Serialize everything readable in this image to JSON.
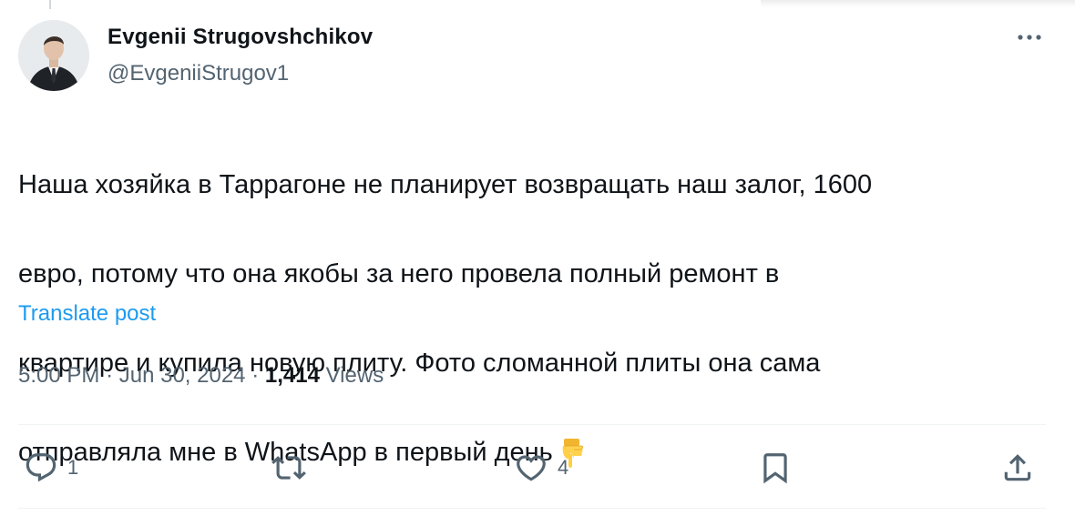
{
  "author": {
    "name": "Evgenii Strugovshchikov",
    "handle": "@EvgeniiStrugov1",
    "avatar_icon": "avatar-photo"
  },
  "post": {
    "text_lines": [
      "Наша хозяйка в Таррагоне не планирует возвращать наш залог, 1600",
      "евро, потому что она якобы за него провела полный ремонт в",
      "квартире и купила новую плиту. Фото сломанной плиты она сама",
      "отправляла мне в WhatsApp в первый день"
    ],
    "emoji": "backhand-index-pointing-down",
    "translate_label": "Translate post"
  },
  "meta": {
    "time": "5:00 PM",
    "separator": "·",
    "date": "Jun 30, 2024",
    "views_count": "1,414",
    "views_label": "Views"
  },
  "actions": {
    "reply_count": "1",
    "retweet_count": "",
    "like_count": "4",
    "icons": [
      "reply-icon",
      "retweet-icon",
      "like-icon",
      "bookmark-icon",
      "share-icon"
    ]
  },
  "colors": {
    "text": "#0f1419",
    "secondary": "#536471",
    "link": "#1d9bf0",
    "divider": "#eff3f4"
  }
}
